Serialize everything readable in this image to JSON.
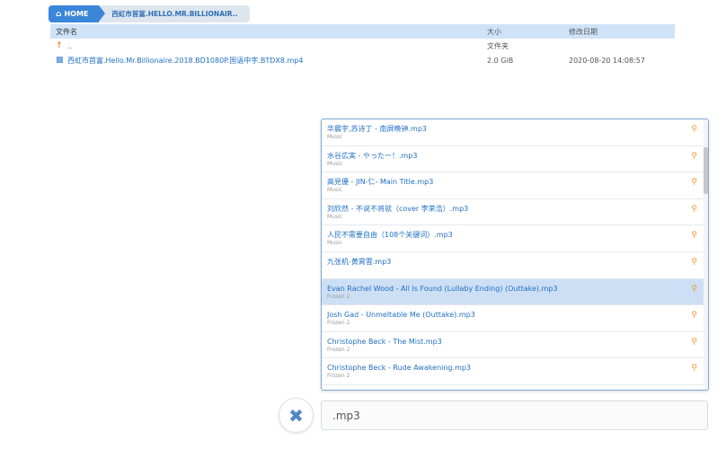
{
  "breadcrumb": {
    "home_label": "HOME",
    "home_icon": "home-icon",
    "current_folder": "西虹市首富.HELLO.MR.BILLIONAIR.."
  },
  "file_table": {
    "headers": {
      "name": "文件名",
      "size": "大小",
      "date": "修改日期"
    },
    "rows": [
      {
        "icon": "up-arrow-icon",
        "name": "..",
        "size": "文件夹",
        "date": ""
      },
      {
        "icon": "video-file-icon",
        "name": "西虹市首富.Hello.Mr.Billionaire.2018.BD1080P.国语中字.BTDX8.mp4",
        "size": "2.0 GiB",
        "date": "2020-08-20 14:08:57"
      }
    ]
  },
  "playlist": {
    "tracks": [
      {
        "title": "华晨宇,苏诗丁 - 南屏晚钟.mp3",
        "album": "Music"
      },
      {
        "title": "水谷広実 - やったー！.mp3",
        "album": "Music"
      },
      {
        "title": "高見優 - JIN-仁- Main Title.mp3",
        "album": "Music"
      },
      {
        "title": "刘欣然 - 不说不将就（cover 李荣浩）.mp3",
        "album": "Music"
      },
      {
        "title": "人民不需要自由（108个关键词）.mp3",
        "album": "Music"
      },
      {
        "title": "九张机-黄霄雲.mp3",
        "album": ""
      },
      {
        "title": "Evan Rachel Wood - All Is Found (Lullaby Ending) (Outtake).mp3",
        "album": "Frozen 2"
      },
      {
        "title": "Josh Gad - Unmeltable Me (Outtake).mp3",
        "album": "Frozen 2"
      },
      {
        "title": "Christophe Beck - The Mist.mp3",
        "album": "Frozen 2"
      },
      {
        "title": "Christophe Beck - Rude Awakening.mp3",
        "album": "Frozen 2"
      }
    ],
    "active_index": 6,
    "pin_icon": "location-pin-icon"
  },
  "controls": {
    "close_icon": "close-icon",
    "close_glyph": "✖",
    "search_value": ".mp3"
  },
  "colors": {
    "accent": "#3a86d9",
    "link": "#1f6fc4",
    "header_bg": "#cfe3f8",
    "active_row": "#cddff4",
    "pin": "#f0962d"
  }
}
